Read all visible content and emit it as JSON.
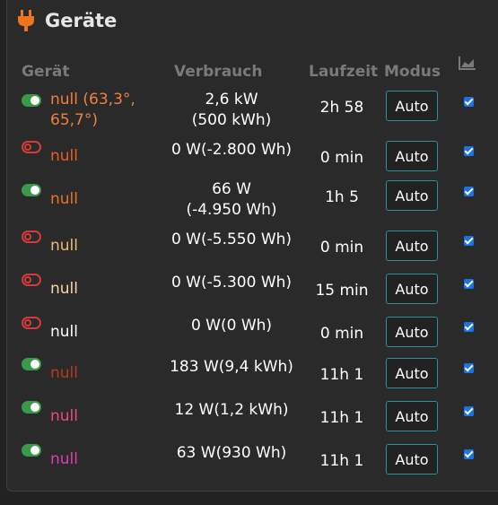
{
  "panel": {
    "title": "Geräte",
    "icon": "power-plug-icon",
    "accent": "#f0731e"
  },
  "columns": {
    "device": "Gerät",
    "consumption": "Verbrauch",
    "runtime": "Laufzeit",
    "mode": "Modus",
    "chart_icon": "area-chart-icon"
  },
  "devices": [
    {
      "on": true,
      "name": "null (63,3°, 65,7°)",
      "name_color": "#f0803c",
      "consumption": "2,6 kW\n(500 kWh)",
      "runtime": "2h 58",
      "mode": "Auto",
      "chart": true
    },
    {
      "on": false,
      "name": "null",
      "name_color": "#ee5a24",
      "consumption": "0 W(-2.800 Wh)",
      "runtime": "0 min",
      "mode": "Auto",
      "chart": true
    },
    {
      "on": true,
      "name": "null",
      "name_color": "#e8732e",
      "consumption": "66 W\n(-4.950 Wh)",
      "runtime": "1h 5",
      "mode": "Auto",
      "chart": true
    },
    {
      "on": false,
      "name": "null",
      "name_color": "#f0b870",
      "consumption": "0 W(-5.550 Wh)",
      "runtime": "0 min",
      "mode": "Auto",
      "chart": true
    },
    {
      "on": false,
      "name": "null",
      "name_color": "#f5d7a8",
      "consumption": "0 W(-5.300 Wh)",
      "runtime": "15 min",
      "mode": "Auto",
      "chart": true
    },
    {
      "on": false,
      "name": "null",
      "name_color": "#ffffff",
      "consumption": "0 W(0 Wh)",
      "runtime": "0 min",
      "mode": "Auto",
      "chart": true
    },
    {
      "on": true,
      "name": "null",
      "name_color": "#b83c1c",
      "consumption": "183 W(9,4 kWh)",
      "runtime": "11h 1",
      "mode": "Auto",
      "chart": true
    },
    {
      "on": true,
      "name": "null",
      "name_color": "#ec4a86",
      "consumption": "12 W(1,2 kWh)",
      "runtime": "11h 1",
      "mode": "Auto",
      "chart": true
    },
    {
      "on": true,
      "name": "null",
      "name_color": "#dd3fb3",
      "consumption": "63 W(930 Wh)",
      "runtime": "11h 1",
      "mode": "Auto",
      "chart": true
    }
  ]
}
